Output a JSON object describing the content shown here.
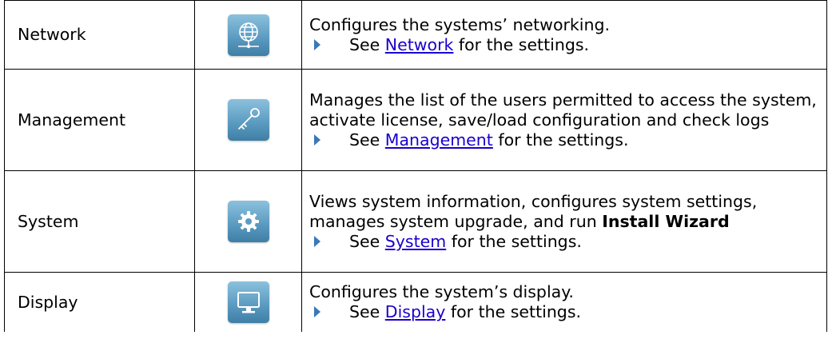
{
  "rows": [
    {
      "name": "Network",
      "icon": "globe-icon",
      "description": "Configures the systems’ networking.",
      "see_prefix": "See",
      "link": "Network",
      "see_suffix": "for the settings."
    },
    {
      "name": "Management",
      "icon": "key-icon",
      "description": "Manages the list of the users permitted to access the system, activate license, save/load configuration and check logs",
      "see_prefix": "See",
      "link": "Management",
      "see_suffix": "for the settings."
    },
    {
      "name": "System",
      "icon": "gear-icon",
      "description": "Views system information, configures system settings, manages system upgrade, and run",
      "description_bold": "Install Wizard",
      "see_prefix": "See",
      "link": "System",
      "see_suffix": "for the settings."
    },
    {
      "name": "Display",
      "icon": "monitor-icon",
      "description": "Configures the system’s display.",
      "see_prefix": "See",
      "link": "Display",
      "see_suffix": "for the settings."
    }
  ],
  "colors": {
    "icon_tile_top": "#8cc1dd",
    "icon_tile_bottom": "#3f7ea5",
    "bullet": "#3a78b8",
    "link": "#1a00cc"
  }
}
